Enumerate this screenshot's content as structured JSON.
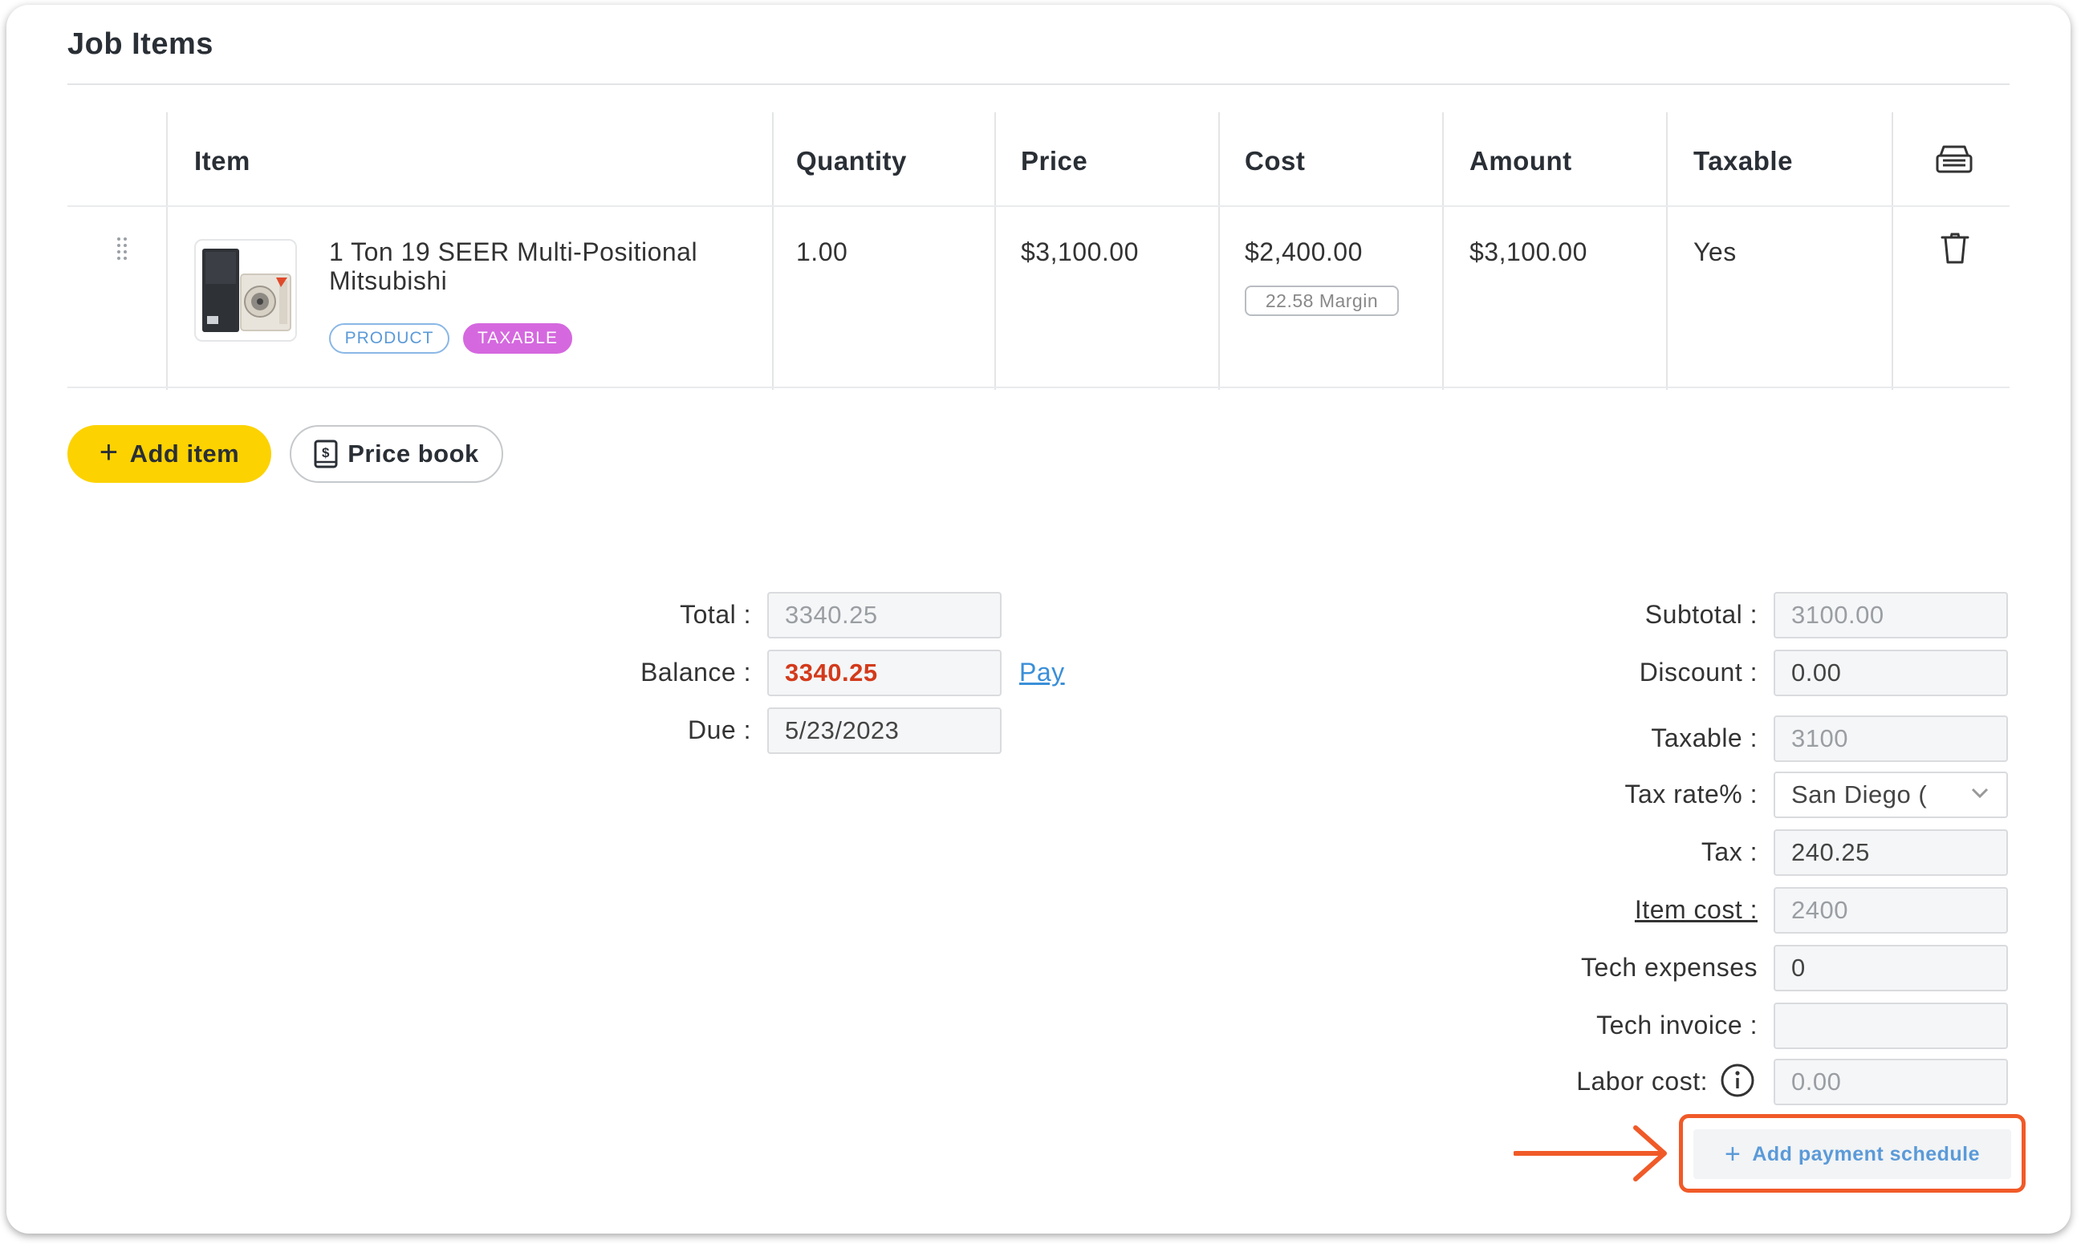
{
  "section": {
    "title": "Job Items"
  },
  "table": {
    "headers": {
      "item": "Item",
      "quantity": "Quantity",
      "price": "Price",
      "cost": "Cost",
      "amount": "Amount",
      "taxable": "Taxable"
    },
    "rows": [
      {
        "name": "1 Ton 19 SEER Multi-Positional Mitsubishi",
        "badges": {
          "product": "PRODUCT",
          "taxable": "TAXABLE"
        },
        "quantity": "1.00",
        "price": "$3,100.00",
        "cost": "$2,400.00",
        "margin": "22.58 Margin",
        "amount": "$3,100.00",
        "taxable": "Yes"
      }
    ]
  },
  "actions": {
    "add_item": "Add item",
    "price_book": "Price book"
  },
  "summary_left": {
    "total_label": "Total :",
    "total_value": "3340.25",
    "balance_label": "Balance :",
    "balance_value": "3340.25",
    "pay_link": "Pay",
    "due_label": "Due :",
    "due_value": "5/23/2023"
  },
  "summary_right": {
    "subtotal_label": "Subtotal :",
    "subtotal_value": "3100.00",
    "discount_label": "Discount :",
    "discount_value": "0.00",
    "taxable_label": "Taxable :",
    "taxable_value": "3100",
    "tax_rate_label": "Tax rate% :",
    "tax_rate_value": "San Diego (",
    "tax_label": "Tax :",
    "tax_value": "240.25",
    "item_cost_label": "Item cost :",
    "item_cost_value": "2400",
    "tech_expenses_label": "Tech expenses",
    "tech_expenses_value": "0",
    "tech_invoice_label": "Tech invoice :",
    "tech_invoice_value": "",
    "labor_cost_label": "Labor cost:",
    "labor_cost_value": "0.00"
  },
  "payment_schedule": {
    "label": "Add payment schedule"
  },
  "colors": {
    "accent_yellow": "#fcd200",
    "taxable_badge": "#d568df",
    "product_badge": "#5b9ad8",
    "balance_red": "#d33a1b",
    "link_blue": "#3a8fd8",
    "highlight_orange": "#f05a28"
  },
  "icons": {
    "drag": "drag-handle-icon",
    "trash": "trash-icon",
    "columns": "columns-settings-icon",
    "price_book": "price-book-icon",
    "info": "info-icon",
    "chevron": "chevron-down-icon",
    "arrow": "arrow-right-icon"
  }
}
